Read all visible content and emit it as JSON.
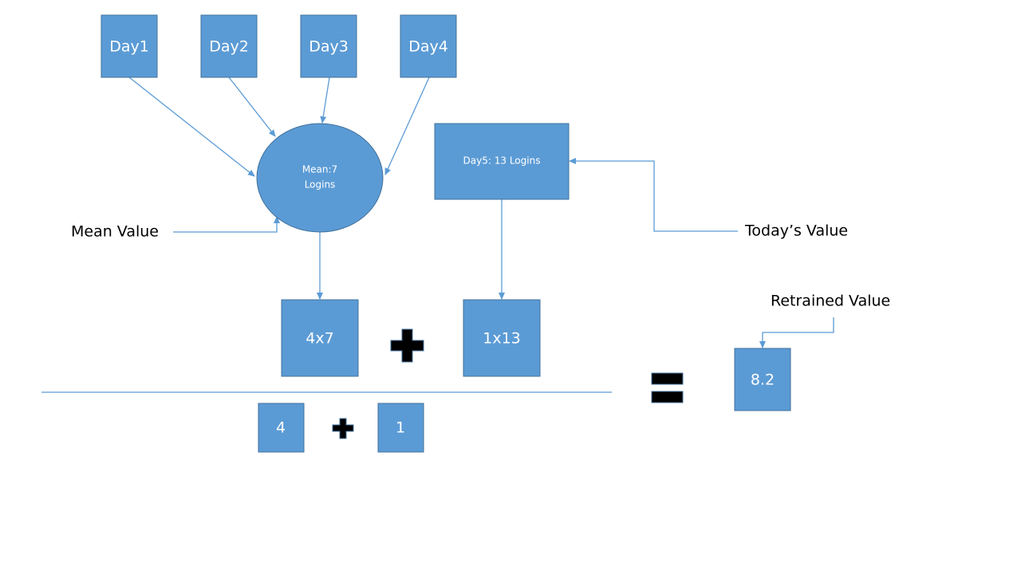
{
  "days": [
    "Day1",
    "Day2",
    "Day3",
    "Day4"
  ],
  "mean": {
    "line1": "Mean:7",
    "line2": "Logins"
  },
  "today_box": "Day5: 13 Logins",
  "labels": {
    "mean_value": "Mean Value",
    "todays_value": "Today’s Value",
    "retrained_value": "Retrained Value"
  },
  "numerator": {
    "left": "4x7",
    "right": "1x13"
  },
  "denominator": {
    "left": "4",
    "right": "1"
  },
  "result": "8.2",
  "colors": {
    "box_fill": "#5b9bd5",
    "box_stroke": "#41719c",
    "operator": "#000000"
  }
}
